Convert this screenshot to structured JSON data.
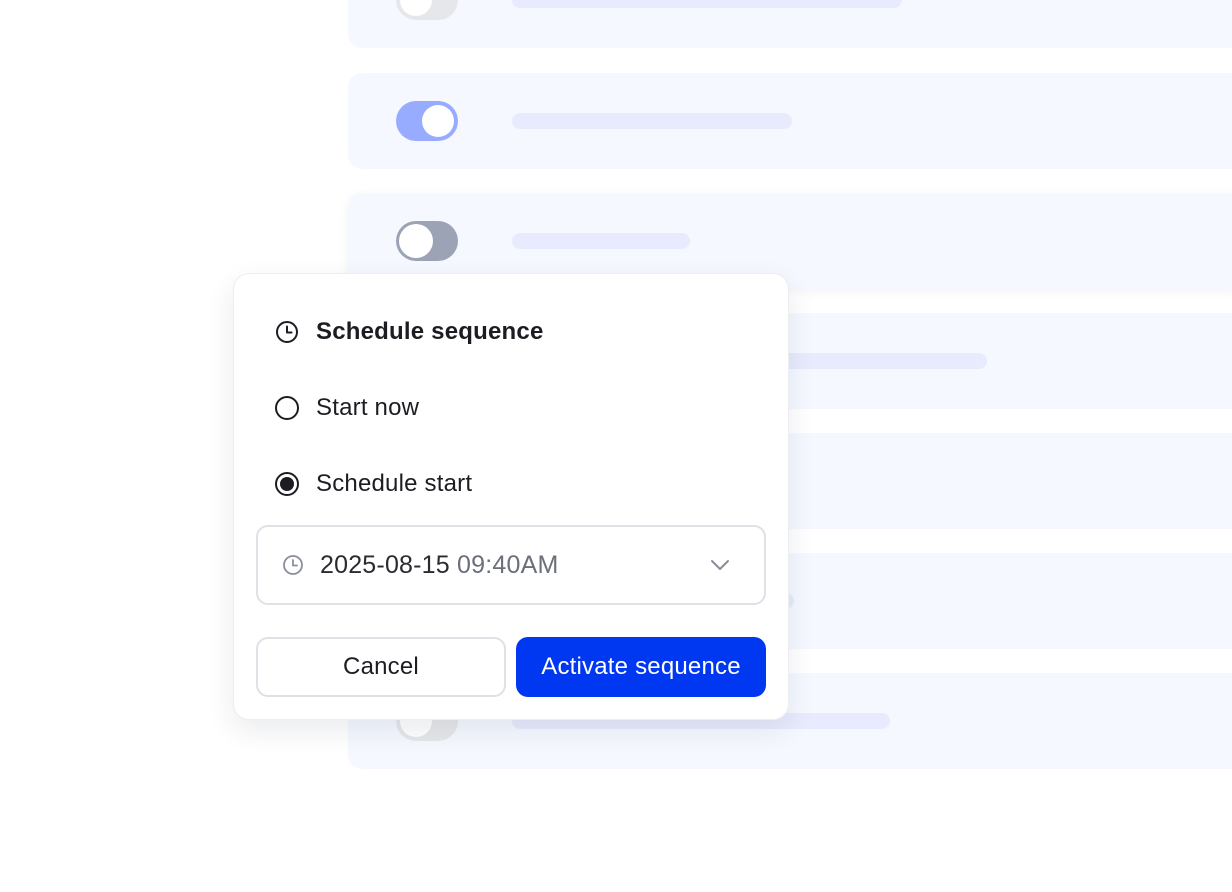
{
  "popover": {
    "title": "Schedule sequence",
    "options": [
      {
        "label": "Start now",
        "selected": false
      },
      {
        "label": "Schedule start",
        "selected": true
      }
    ],
    "datetime": {
      "date": "2025-08-15",
      "time": "09:40AM"
    },
    "cancel_label": "Cancel",
    "activate_label": "Activate sequence"
  },
  "background_rows": [
    {
      "toggle": "off"
    },
    {
      "toggle": "on"
    },
    {
      "toggle": "off"
    },
    {
      "toggle": "none"
    },
    {
      "toggle": "none"
    },
    {
      "toggle": "none"
    },
    {
      "toggle": "off"
    }
  ],
  "colors": {
    "accent": "#0037f0",
    "toggle_on": "#97acff",
    "toggle_off": "#e6e7ea",
    "row_background": "#f5f8ff",
    "skeleton_bar": "#e8ebfd"
  }
}
